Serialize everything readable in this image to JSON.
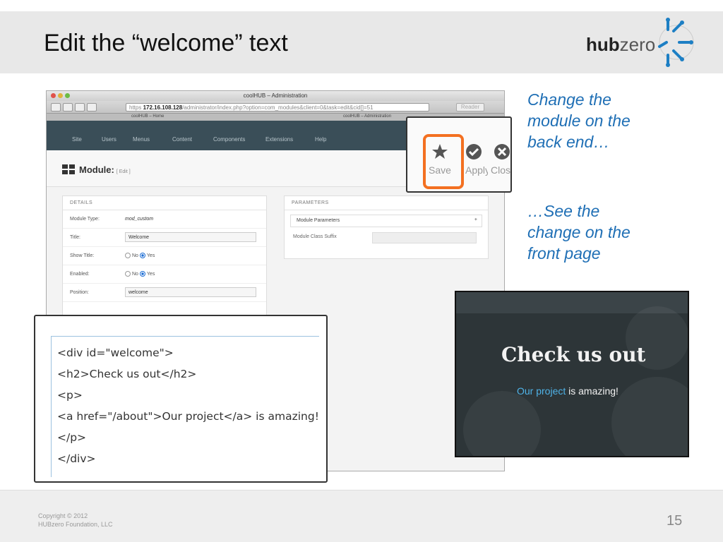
{
  "slide": {
    "title": "Edit the “welcome” text",
    "page_number": "15",
    "copyright_line1": "Copyright © 2012",
    "copyright_line2": "HUBzero Foundation, LLC"
  },
  "logo": {
    "text_bold": "hub",
    "text_light": "zero",
    "accent_color": "#1d7fc4"
  },
  "captions": {
    "back_end": [
      "Change the",
      "module on the",
      "back end…"
    ],
    "front_page": [
      "…See the",
      "change on the",
      "front page"
    ],
    "color": "#1f6fb5"
  },
  "browser": {
    "window_title": "coolHUB – Administration",
    "address_host": "172.16.108.128",
    "address_prefix": "https",
    "address_path": "/administrator/index.php?option=com_modules&client=0&task=edit&cid[]=51",
    "reader_label": "Reader",
    "tab_home": "coolHUB – Home",
    "tab_admin": "coolHUB – Administration",
    "nav_items": [
      "Site",
      "Users",
      "Menus",
      "Content",
      "Components",
      "Extensions",
      "Help"
    ],
    "module_label": "Module:",
    "module_sub": "[ Edit ]",
    "details": {
      "title": "DETAILS",
      "module_type_label": "Module Type:",
      "module_type_value": "mod_custom",
      "title_label": "Title:",
      "title_value": "Welcome",
      "show_title_label": "Show Title:",
      "enabled_label": "Enabled:",
      "position_label": "Position:",
      "position_value": "welcome",
      "no_label": "No",
      "yes_label": "Yes"
    },
    "parameters": {
      "title": "PARAMETERS",
      "module_parameters": "Module Parameters",
      "module_class_suffix": "Module Class Suffix"
    }
  },
  "toolbar_callout": {
    "save_label": "Save",
    "apply_label": "Apply",
    "close_label": "Clos",
    "highlight_color": "#f37021"
  },
  "code": [
    "<div id=\"welcome\">",
    "<h2>Check us out</h2>",
    "<p>",
    "<a href=\"/about\">Our project</a> is amazing!",
    "</p>",
    "</div>"
  ],
  "front": {
    "heading": "Check us out",
    "link_text": "Our project",
    "rest_text": " is amazing!"
  }
}
